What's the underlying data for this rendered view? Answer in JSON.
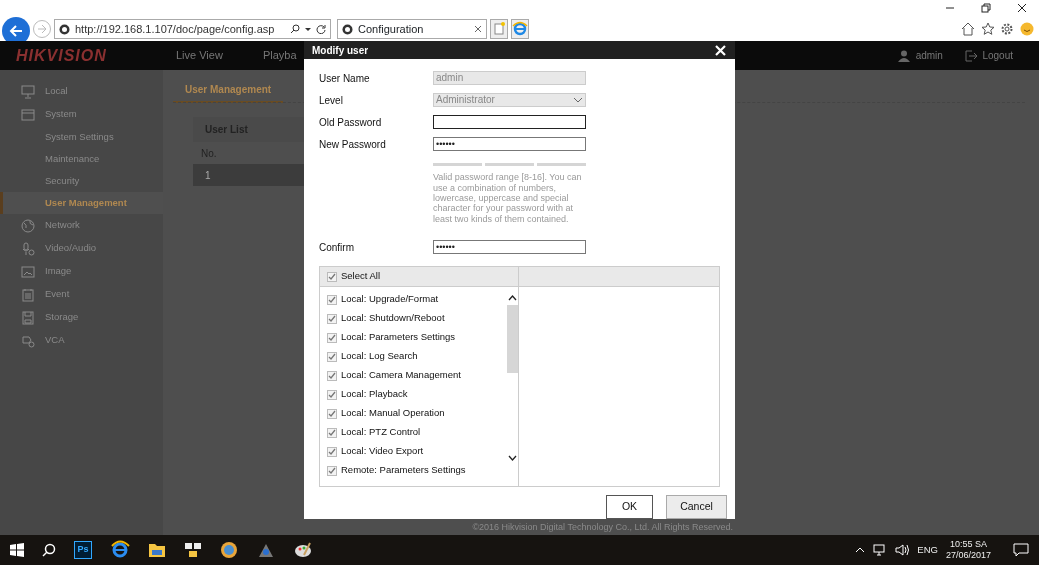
{
  "browser": {
    "url": "http://192.168.1.107/doc/page/config.asp",
    "tab": "Configuration"
  },
  "header": {
    "logo": "HIKVISION",
    "nav": [
      "Live View",
      "Playba"
    ],
    "user": "admin",
    "logout": "Logout"
  },
  "sidebar": {
    "items": [
      {
        "label": "Local"
      },
      {
        "label": "System",
        "expanded": true,
        "children": [
          {
            "label": "System Settings",
            "selected": false
          },
          {
            "label": "Maintenance",
            "selected": false
          },
          {
            "label": "Security",
            "selected": false
          },
          {
            "label": "User Management",
            "selected": true
          }
        ]
      },
      {
        "label": "Network"
      },
      {
        "label": "Video/Audio"
      },
      {
        "label": "Image"
      },
      {
        "label": "Event"
      },
      {
        "label": "Storage"
      },
      {
        "label": "VCA"
      }
    ]
  },
  "content": {
    "tab": "User Management",
    "user_list": {
      "title": "User List",
      "columns": [
        "No."
      ],
      "rows": [
        {
          "cells": [
            "1"
          ],
          "selected": true
        }
      ]
    },
    "footer": "©2016 Hikvision Digital Technology Co., Ltd. All Rights Reserved."
  },
  "dialog": {
    "title": "Modify user",
    "fields": [
      {
        "label": "User Name",
        "kind": "text",
        "value": "admin",
        "disabled": true
      },
      {
        "label": "Level",
        "kind": "select",
        "value": "Administrator",
        "disabled": true
      },
      {
        "label": "Old Password",
        "kind": "password"
      },
      {
        "label": "New Password",
        "kind": "password",
        "value": "••••••"
      },
      {
        "kind": "strength",
        "level": 0
      },
      {
        "kind": "hint",
        "value": "Valid password range [8-16]. You can use a combination of numbers, lowercase, uppercase and special character for your password with at least two kinds of them contained."
      },
      {
        "label": "Confirm",
        "kind": "password",
        "value": "••••••"
      }
    ],
    "permissions": {
      "select_all": {
        "label": "Select All",
        "checked": true
      },
      "items": [
        {
          "label": "Local: Upgrade/Format",
          "checked": true
        },
        {
          "label": "Local: Shutdown/Reboot",
          "checked": true
        },
        {
          "label": "Local: Parameters Settings",
          "checked": true
        },
        {
          "label": "Local: Log Search",
          "checked": true
        },
        {
          "label": "Local: Camera Management",
          "checked": true
        },
        {
          "label": "Local: Playback",
          "checked": true
        },
        {
          "label": "Local: Manual Operation",
          "checked": true
        },
        {
          "label": "Local: PTZ Control",
          "checked": true
        },
        {
          "label": "Local: Video Export",
          "checked": true
        },
        {
          "label": "Remote: Parameters Settings",
          "checked": true
        }
      ]
    },
    "buttons": [
      "OK",
      "Cancel"
    ]
  },
  "taskbar": {
    "apps": [
      {
        "label": "Ps"
      }
    ],
    "language": "ENG",
    "time": "10:55 SA",
    "date": "27/06/2017"
  }
}
